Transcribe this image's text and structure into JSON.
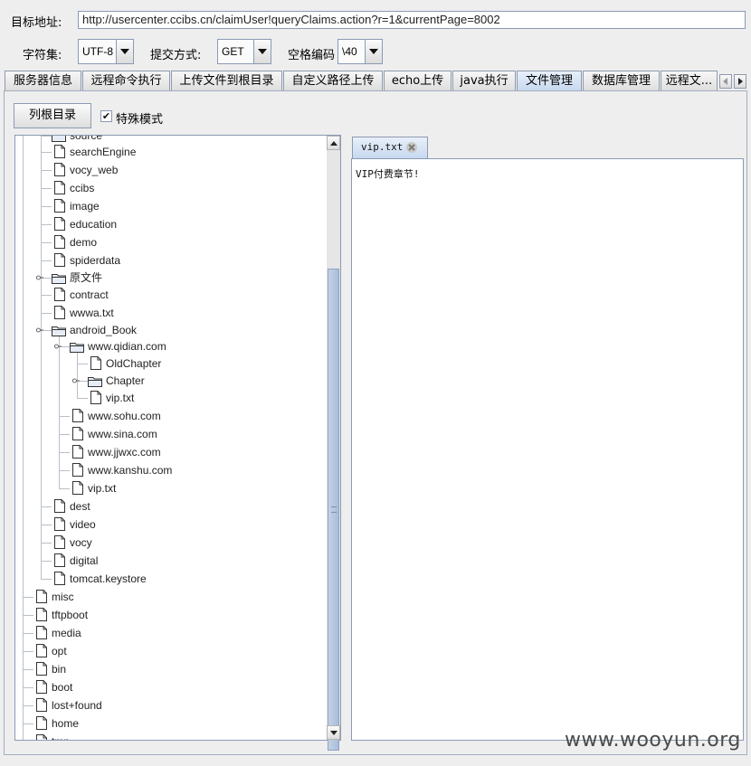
{
  "form": {
    "target_label": "目标地址:",
    "target_url": "http://usercenter.ccibs.cn/claimUser!queryClaims.action?r=1&currentPage=8002",
    "charset_label": "字符集:",
    "charset_value": "UTF-8",
    "method_label": "提交方式:",
    "method_value": "GET",
    "space_label": "空格编码",
    "space_value": "\\40"
  },
  "tabs": [
    "服务器信息",
    "远程命令执行",
    "上传文件到根目录",
    "自定义路径上传",
    "echo上传",
    "java执行",
    "文件管理",
    "数据库管理",
    "远程文..."
  ],
  "active_tab": "文件管理",
  "toolbar": {
    "list_root_label": "列根目录",
    "special_mode_label": "特殊模式",
    "special_mode_checked": "✔"
  },
  "tree": {
    "items": [
      {
        "label": "source",
        "type": "folder"
      },
      {
        "label": "searchEngine",
        "type": "file"
      },
      {
        "label": "vocy_web",
        "type": "file"
      },
      {
        "label": "ccibs",
        "type": "file"
      },
      {
        "label": "image",
        "type": "file"
      },
      {
        "label": "education",
        "type": "file"
      },
      {
        "label": "demo",
        "type": "file"
      },
      {
        "label": "spiderdata",
        "type": "file"
      },
      {
        "label": "原文件",
        "type": "folder"
      },
      {
        "label": "contract",
        "type": "file"
      },
      {
        "label": "wwwa.txt",
        "type": "file"
      },
      {
        "label": "android_Book",
        "type": "folder"
      },
      {
        "label": "www.qidian.com",
        "type": "folder"
      },
      {
        "label": "OldChapter",
        "type": "file"
      },
      {
        "label": "Chapter",
        "type": "folder"
      },
      {
        "label": "vip.txt",
        "type": "file"
      },
      {
        "label": "www.sohu.com",
        "type": "file"
      },
      {
        "label": "www.sina.com",
        "type": "file"
      },
      {
        "label": "www.jjwxc.com",
        "type": "file"
      },
      {
        "label": "www.kanshu.com",
        "type": "file"
      },
      {
        "label": "vip.txt",
        "type": "file"
      },
      {
        "label": "dest",
        "type": "file"
      },
      {
        "label": "video",
        "type": "file"
      },
      {
        "label": "vocy",
        "type": "file"
      },
      {
        "label": "digital",
        "type": "file"
      },
      {
        "label": "tomcat.keystore",
        "type": "file"
      },
      {
        "label": "misc",
        "type": "file"
      },
      {
        "label": "tftpboot",
        "type": "file"
      },
      {
        "label": "media",
        "type": "file"
      },
      {
        "label": "opt",
        "type": "file"
      },
      {
        "label": "bin",
        "type": "file"
      },
      {
        "label": "boot",
        "type": "file"
      },
      {
        "label": "lost+found",
        "type": "file"
      },
      {
        "label": "home",
        "type": "file"
      },
      {
        "label": "tmp",
        "type": "file"
      }
    ]
  },
  "editor": {
    "tab_label": "vip.txt",
    "content": "VIP付费章节!"
  },
  "watermark": "www.wooyun.org"
}
